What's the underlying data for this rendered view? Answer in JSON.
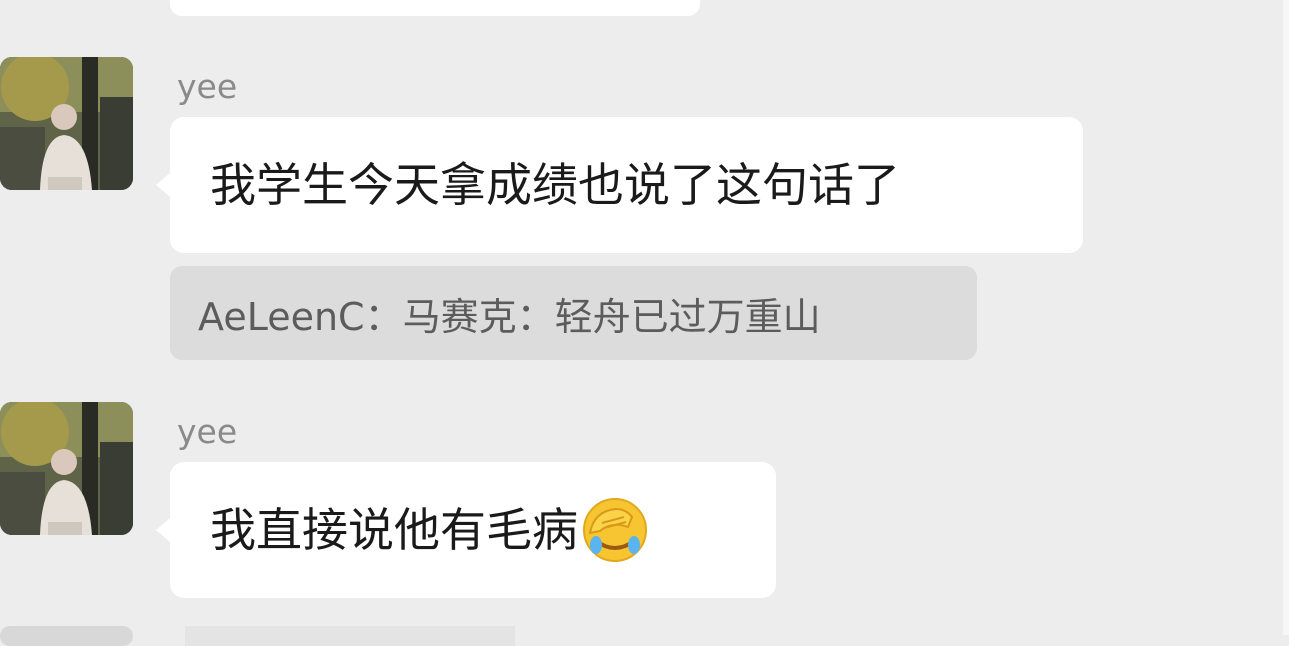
{
  "messages": [
    {
      "sender": "yee",
      "text": "我学生今天拿成绩也说了这句话了",
      "quote": "AeLeenC：马赛克：轻舟已过万重山"
    },
    {
      "sender": "yee",
      "text": "我直接说他有毛病",
      "emoji": "facepalm-emoji"
    }
  ],
  "colors": {
    "background": "#ededed",
    "bubble": "#ffffff",
    "quote_bg": "#dcdcdc",
    "sender_text": "#8a8a8a"
  }
}
